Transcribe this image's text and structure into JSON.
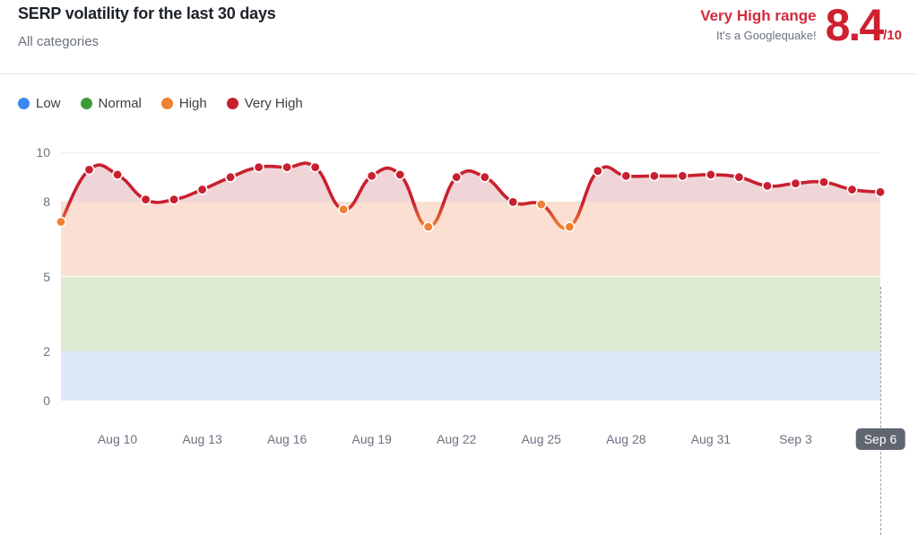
{
  "header": {
    "title": "SERP volatility for the last 30 days",
    "subtitle": "All categories",
    "range_label": "Very High range",
    "range_sub": "It's a Googlequake!",
    "score_value": "8.4",
    "score_denominator": "/10"
  },
  "legend": [
    {
      "label": "Low",
      "color": "#3b87f0",
      "icon": "legend-dot-icon"
    },
    {
      "label": "Normal",
      "color": "#3f9b35",
      "icon": "legend-dot-icon"
    },
    {
      "label": "High",
      "color": "#f08033",
      "icon": "legend-dot-icon"
    },
    {
      "label": "Very High",
      "color": "#c8202f",
      "icon": "legend-dot-icon"
    }
  ],
  "chart_data": {
    "type": "line",
    "title": "SERP volatility for the last 30 days",
    "subtitle": "All categories",
    "xlabel": "",
    "ylabel": "",
    "ylim": [
      0,
      10
    ],
    "yticks": [
      10,
      8,
      5,
      2,
      0
    ],
    "grid": false,
    "legend_position": "top-left",
    "x": [
      "Aug 8",
      "Aug 9",
      "Aug 10",
      "Aug 11",
      "Aug 12",
      "Aug 13",
      "Aug 14",
      "Aug 15",
      "Aug 16",
      "Aug 17",
      "Aug 18",
      "Aug 19",
      "Aug 20",
      "Aug 21",
      "Aug 22",
      "Aug 23",
      "Aug 24",
      "Aug 25",
      "Aug 26",
      "Aug 27",
      "Aug 28",
      "Aug 29",
      "Aug 30",
      "Aug 31",
      "Sep 1",
      "Sep 2",
      "Sep 3",
      "Sep 4",
      "Sep 5",
      "Sep 6"
    ],
    "xticks": [
      "Aug 10",
      "Aug 13",
      "Aug 16",
      "Aug 19",
      "Aug 22",
      "Aug 25",
      "Aug 28",
      "Aug 31",
      "Sep 3",
      "Sep 6"
    ],
    "xtick_current": "Sep 6",
    "series": [
      {
        "name": "SERP volatility",
        "values": [
          7.2,
          9.3,
          9.1,
          8.1,
          8.1,
          8.5,
          9.0,
          9.4,
          9.4,
          9.4,
          7.7,
          9.05,
          9.1,
          7.0,
          9.0,
          9.0,
          8.0,
          7.9,
          7.0,
          9.25,
          9.05,
          9.05,
          9.05,
          9.1,
          9.0,
          8.65,
          8.75,
          8.8,
          8.5,
          8.4
        ]
      }
    ],
    "bands": [
      {
        "name": "Low",
        "from": 0,
        "to": 2,
        "color": "#dce8fa"
      },
      {
        "name": "Normal",
        "from": 2,
        "to": 5,
        "color": "#dfead4"
      },
      {
        "name": "High",
        "from": 5,
        "to": 8,
        "color": "#fbdfd2"
      },
      {
        "name": "Very High",
        "from": 8,
        "to": 10,
        "color": "#f0d5d8"
      }
    ],
    "point_colors": {
      "high": "#f08033",
      "very_high": "#c8202f"
    },
    "very_high_threshold": 8
  }
}
